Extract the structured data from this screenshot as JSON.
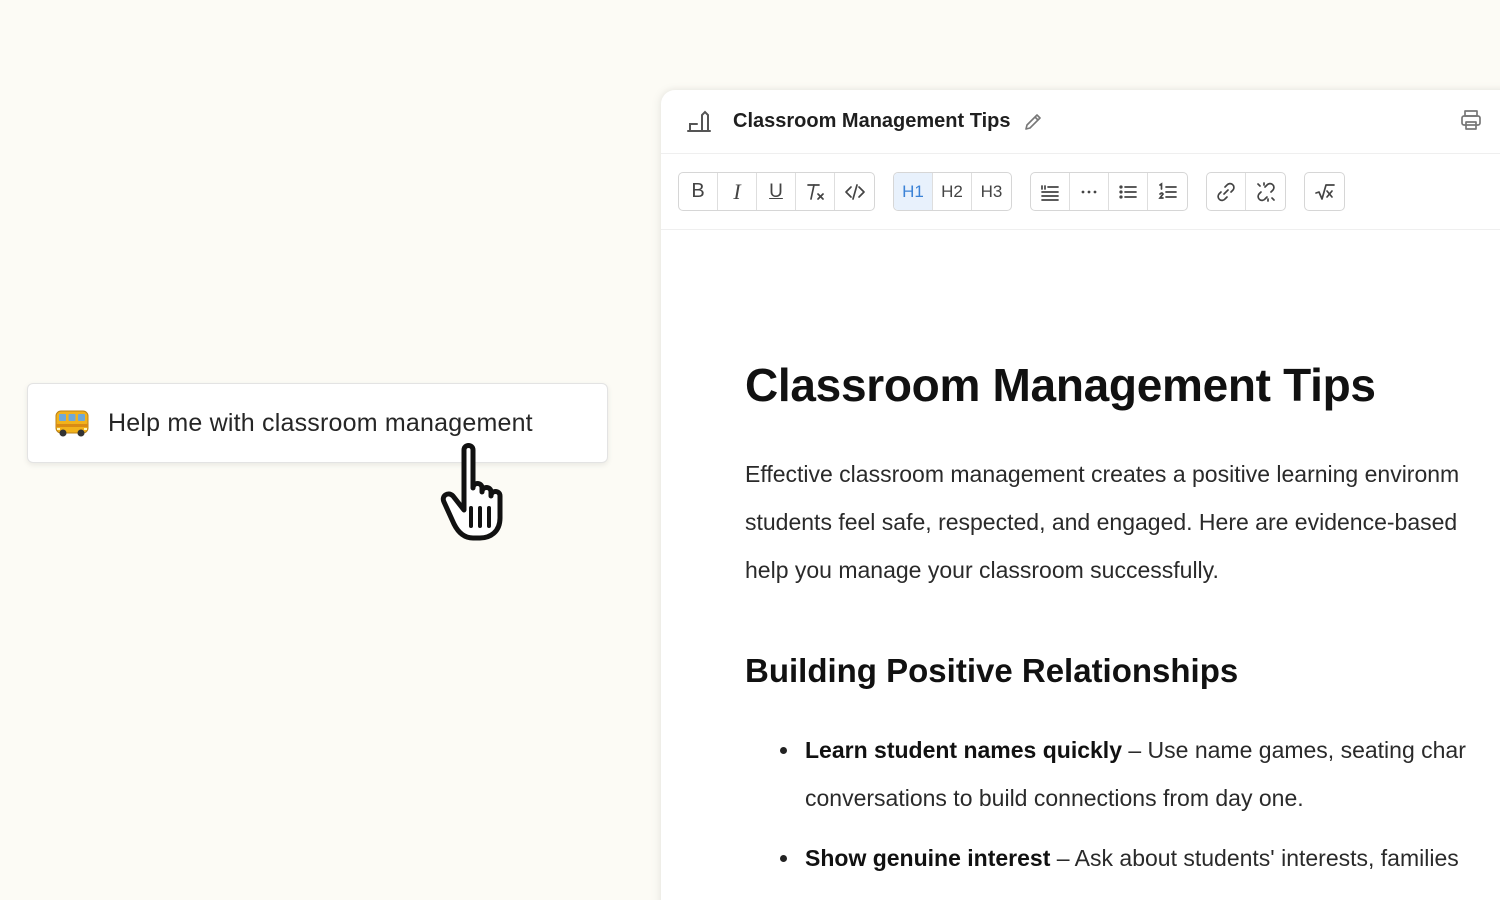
{
  "prompt": {
    "icon": "bus-emoji-icon",
    "label": "Help me with classroom management"
  },
  "editor": {
    "header": {
      "title": "Classroom Management Tips",
      "doc_icon": "document-icon",
      "edit_icon": "pencil-icon",
      "print_icon": "printer-icon"
    },
    "toolbar": {
      "groups": [
        [
          "bold",
          "italic",
          "underline",
          "clear-format",
          "code"
        ],
        [
          "h1",
          "h2",
          "h3"
        ],
        [
          "blockquote",
          "horizontal-rule",
          "bullet-list",
          "ordered-list"
        ],
        [
          "link",
          "unlink"
        ],
        [
          "math"
        ]
      ],
      "active": "h1",
      "labels": {
        "bold": "B",
        "italic": "I",
        "underline": "U",
        "h1": "H1",
        "h2": "H2",
        "h3": "H3"
      }
    },
    "content": {
      "h1": "Classroom Management Tips",
      "intro_lines": [
        "Effective classroom management creates a positive learning environm",
        "students feel safe, respected, and engaged. Here are evidence-based",
        "help you manage your classroom successfully."
      ],
      "h2": "Building Positive Relationships",
      "bullets": [
        {
          "bold": "Learn student names quickly",
          "line1": " – Use name games, seating char",
          "line2": "conversations to build connections from day one."
        },
        {
          "bold": "Show genuine interest",
          "line1": " – Ask about students' interests, families",
          "line2": ""
        }
      ]
    }
  },
  "colors": {
    "background": "#fcfbf5",
    "active_accent": "#3b82d6",
    "active_bg": "#e8f1fc"
  }
}
